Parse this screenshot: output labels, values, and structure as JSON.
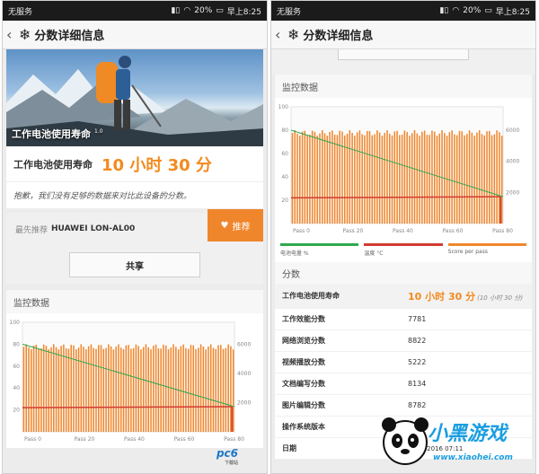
{
  "status": {
    "carrier": "无服务",
    "battery": "20%",
    "time": "早上8:25"
  },
  "header": {
    "back_icon": "chevron-left-icon",
    "logo_icon": "snowflake-icon",
    "title": "分数详细信息"
  },
  "hero": {
    "caption": "工作电池使用寿命",
    "version": "1.0"
  },
  "result": {
    "label": "工作电池使用寿命",
    "value": "10 小时 30 分"
  },
  "notice": "抱歉，我们没有足够的数据来对比此设备的分数。",
  "recommend": {
    "prefix": "最先推荐",
    "device": "HUAWEI LON-AL00",
    "button_label": "推荐"
  },
  "share_label": "共享",
  "monitor_title": "监控数据",
  "chart_data": {
    "type": "line",
    "x_ticks": [
      "Pass 0",
      "Pass 20",
      "Pass 40",
      "Pass 60",
      "Pass 80"
    ],
    "left_ticks": [
      "20",
      "40",
      "60",
      "80",
      "100"
    ],
    "right_ticks": [
      "2000",
      "4000",
      "6000"
    ],
    "ylim_left": [
      0,
      100
    ],
    "ylim_right": [
      0,
      7500
    ],
    "passes": 85,
    "series": [
      {
        "name": "电池电量 %",
        "color": "#2fa84f",
        "points": [
          [
            0,
            80
          ],
          [
            85,
            23
          ]
        ]
      },
      {
        "name": "温度 °C",
        "color": "#d23b33",
        "points": [
          [
            0,
            22
          ],
          [
            85,
            23
          ]
        ]
      },
      {
        "name": "Score per pass",
        "color": "#f0862c",
        "value": 6000
      }
    ],
    "end_drop_pass": 84
  },
  "scores": {
    "title": "分数",
    "rows": [
      {
        "label": "工作电池使用寿命",
        "value": "10 小时 30 分",
        "note": "(10 小时 30 分)"
      },
      {
        "label": "工作效能分数",
        "value": "7781"
      },
      {
        "label": "网络浏览分数",
        "value": "8822"
      },
      {
        "label": "视频播放分数",
        "value": "5222"
      },
      {
        "label": "文档编写分数",
        "value": "8134"
      },
      {
        "label": "图片编辑分数",
        "value": "8782"
      },
      {
        "label": "操作系统版本",
        "value": ""
      },
      {
        "label": "日期",
        "value": "11 2016 07:11"
      }
    ]
  },
  "watermarks": {
    "pc6": "pc6",
    "pc6_sub": "下载站",
    "site_text": "小黑游戏",
    "site_url": "www.xiaohei.com"
  }
}
